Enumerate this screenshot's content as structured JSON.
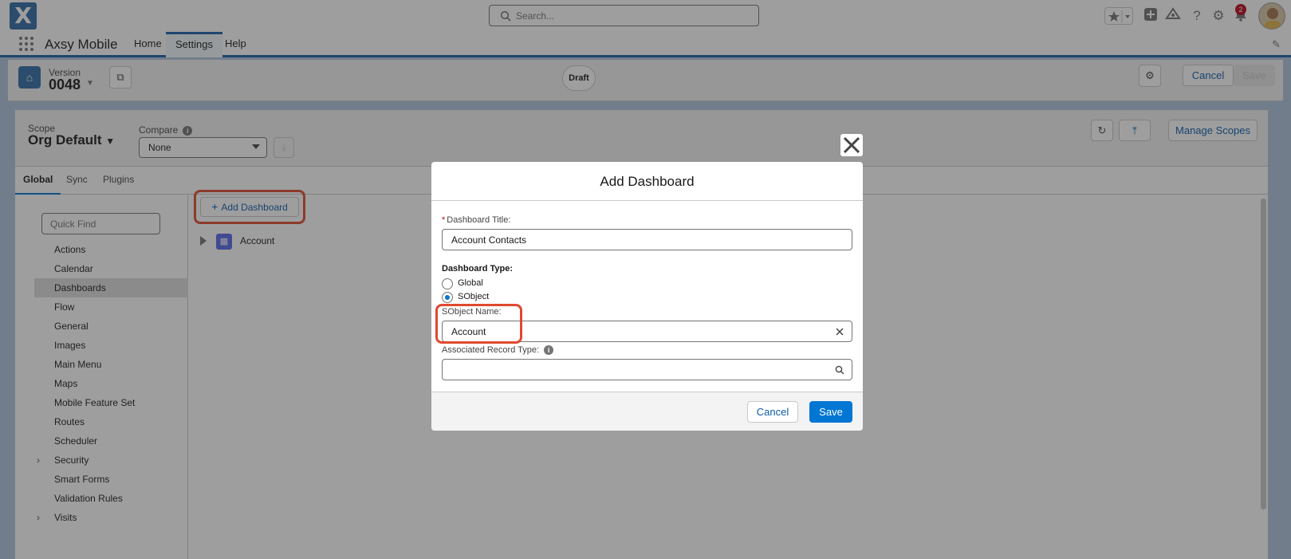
{
  "header": {
    "logo_text": "X",
    "search_placeholder": "Search...",
    "notification_count": "2"
  },
  "nav": {
    "app_name": "Axsy Mobile",
    "tabs": [
      {
        "label": "Home",
        "active": false
      },
      {
        "label": "Settings",
        "active": true
      },
      {
        "label": "Help",
        "active": false
      }
    ]
  },
  "page_header": {
    "version_label": "Version",
    "version_number": "0048",
    "status": "Draft",
    "cancel_label": "Cancel",
    "save_label": "Save"
  },
  "scope": {
    "label": "Scope",
    "value": "Org Default",
    "compare_label": "Compare",
    "compare_value": "None",
    "manage_label": "Manage Scopes"
  },
  "tabs": [
    {
      "label": "Global",
      "active": true
    },
    {
      "label": "Sync",
      "active": false
    },
    {
      "label": "Plugins",
      "active": false
    }
  ],
  "sidebar": {
    "quick_find_placeholder": "Quick Find",
    "items": [
      {
        "label": "Actions",
        "active": false,
        "expandable": false
      },
      {
        "label": "Calendar",
        "active": false,
        "expandable": false
      },
      {
        "label": "Dashboards",
        "active": true,
        "expandable": false
      },
      {
        "label": "Flow",
        "active": false,
        "expandable": false
      },
      {
        "label": "General",
        "active": false,
        "expandable": false
      },
      {
        "label": "Images",
        "active": false,
        "expandable": false
      },
      {
        "label": "Main Menu",
        "active": false,
        "expandable": false
      },
      {
        "label": "Maps",
        "active": false,
        "expandable": false
      },
      {
        "label": "Mobile Feature Set",
        "active": false,
        "expandable": false
      },
      {
        "label": "Routes",
        "active": false,
        "expandable": false
      },
      {
        "label": "Scheduler",
        "active": false,
        "expandable": false
      },
      {
        "label": "Security",
        "active": false,
        "expandable": true
      },
      {
        "label": "Smart Forms",
        "active": false,
        "expandable": false
      },
      {
        "label": "Validation Rules",
        "active": false,
        "expandable": false
      },
      {
        "label": "Visits",
        "active": false,
        "expandable": true
      }
    ]
  },
  "content": {
    "add_dashboard_label": "Add Dashboard",
    "tree_items": [
      {
        "label": "Account"
      }
    ]
  },
  "modal": {
    "title": "Add Dashboard",
    "dashboard_title_label": "Dashboard Title:",
    "required_marker": "*",
    "dashboard_title_value": "Account Contacts",
    "dashboard_type_label": "Dashboard Type:",
    "types": [
      {
        "label": "Global",
        "checked": false
      },
      {
        "label": "SObject",
        "checked": true
      }
    ],
    "sobject_name_label": "SObject Name:",
    "sobject_name_value": "Account",
    "record_type_label": "Associated Record Type:",
    "record_type_value": "",
    "cancel_label": "Cancel",
    "save_label": "Save"
  },
  "colors": {
    "brand": "#0176d3",
    "highlight": "#e0492f",
    "nav_accent": "#1b5fa8"
  }
}
